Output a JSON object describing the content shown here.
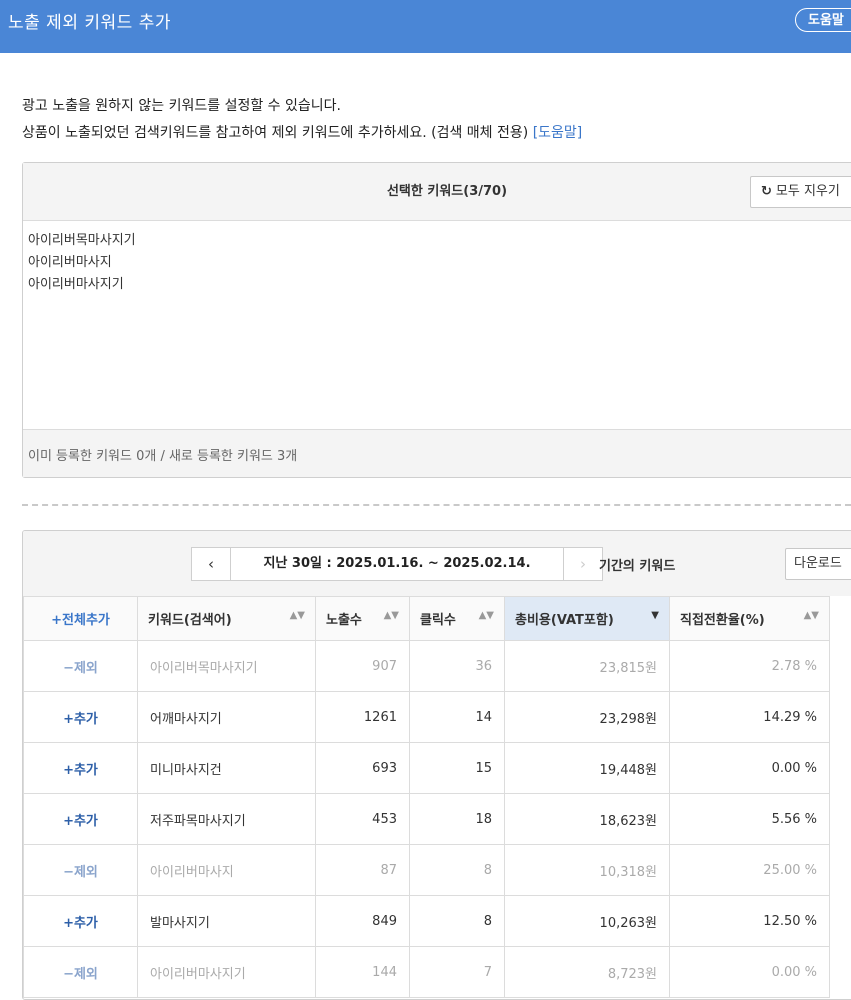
{
  "header": {
    "title": "노출 제외 키워드 추가",
    "help_label": "도움말"
  },
  "description": {
    "line1": "광고 노출을 원하지 않는 키워드를 설정할 수 있습니다.",
    "line2": "상품이 노출되었던 검색키워드를 참고하여 제외 키워드에 추가하세요. (검색 매체 전용) ",
    "help_link": "[도움말]"
  },
  "selected_panel": {
    "title": "선택한 키워드(3/70)",
    "clear_icon": "refresh-icon",
    "clear_label": "모두 지우기",
    "keywords": [
      "아이리버목마사지기",
      "아이리버마사지",
      "아이리버마사지기"
    ],
    "footer": "이미 등록한 키워드 0개 / 새로 등록한 키워드 3개"
  },
  "period": {
    "prev_label": "‹",
    "next_label": "›",
    "range": "지난 30일 : 2025.01.16. ~ 2025.02.14.",
    "suffix": "기간의 키워드",
    "download_label": "다운로드"
  },
  "table": {
    "columns": [
      "+전체추가",
      "키워드(검색어)",
      "노출수",
      "클릭수",
      "총비용(VAT포함)",
      "직접전환율(%)"
    ],
    "sorted_column": "총비용(VAT포함)",
    "rows": [
      {
        "action": "−제외",
        "state": "excluded",
        "keyword": "아이리버목마사지기",
        "impressions": "907",
        "clicks": "36",
        "cost": "23,815원",
        "cvr": "2.78 %"
      },
      {
        "action": "+추가",
        "state": "available",
        "keyword": "어깨마사지기",
        "impressions": "1261",
        "clicks": "14",
        "cost": "23,298원",
        "cvr": "14.29 %"
      },
      {
        "action": "+추가",
        "state": "available",
        "keyword": "미니마사지건",
        "impressions": "693",
        "clicks": "15",
        "cost": "19,448원",
        "cvr": "0.00 %"
      },
      {
        "action": "+추가",
        "state": "available",
        "keyword": "저주파목마사지기",
        "impressions": "453",
        "clicks": "18",
        "cost": "18,623원",
        "cvr": "5.56 %"
      },
      {
        "action": "−제외",
        "state": "excluded",
        "keyword": "아이리버마사지",
        "impressions": "87",
        "clicks": "8",
        "cost": "10,318원",
        "cvr": "25.00 %"
      },
      {
        "action": "+추가",
        "state": "available",
        "keyword": "발마사지기",
        "impressions": "849",
        "clicks": "8",
        "cost": "10,263원",
        "cvr": "12.50 %"
      },
      {
        "action": "−제외",
        "state": "excluded",
        "keyword": "아이리버마사지기",
        "impressions": "144",
        "clicks": "7",
        "cost": "8,723원",
        "cvr": "0.00 %"
      }
    ]
  },
  "colors": {
    "header_bg": "#4a86d6",
    "link": "#3a76c9",
    "sorted_header_bg": "#dfe9f5"
  }
}
